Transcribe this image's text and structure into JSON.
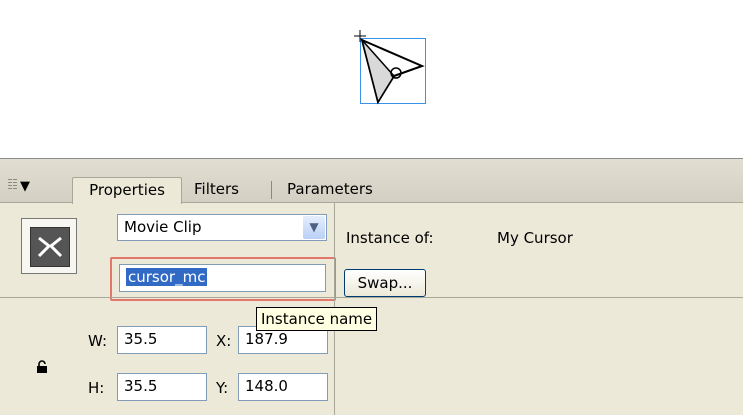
{
  "panel": {
    "tabs": [
      "Properties",
      "Filters",
      "Parameters"
    ],
    "symbol_type": "Movie Clip",
    "instance_name": "cursor_mc",
    "instance_of_label": "Instance of:",
    "instance_of_value": "My Cursor",
    "swap_label": "Swap...",
    "tooltip": "Instance name",
    "w_label": "W:",
    "w_value": "35.5",
    "h_label": "H:",
    "h_value": "35.5",
    "x_label": "X:",
    "x_value": "187.9",
    "y_label": "Y:",
    "y_value": "148.0"
  },
  "icons": {
    "collapse": "triangle-down-icon",
    "lock": "lock-icon",
    "symbol": "movie-clip-icon",
    "stage_cursor": "cursor-arrow-icon"
  },
  "colors": {
    "selection": "#3a93e6",
    "highlight_box": "#e2776c",
    "panel_bg": "#ece9d8",
    "text_selection": "#316ac5"
  }
}
